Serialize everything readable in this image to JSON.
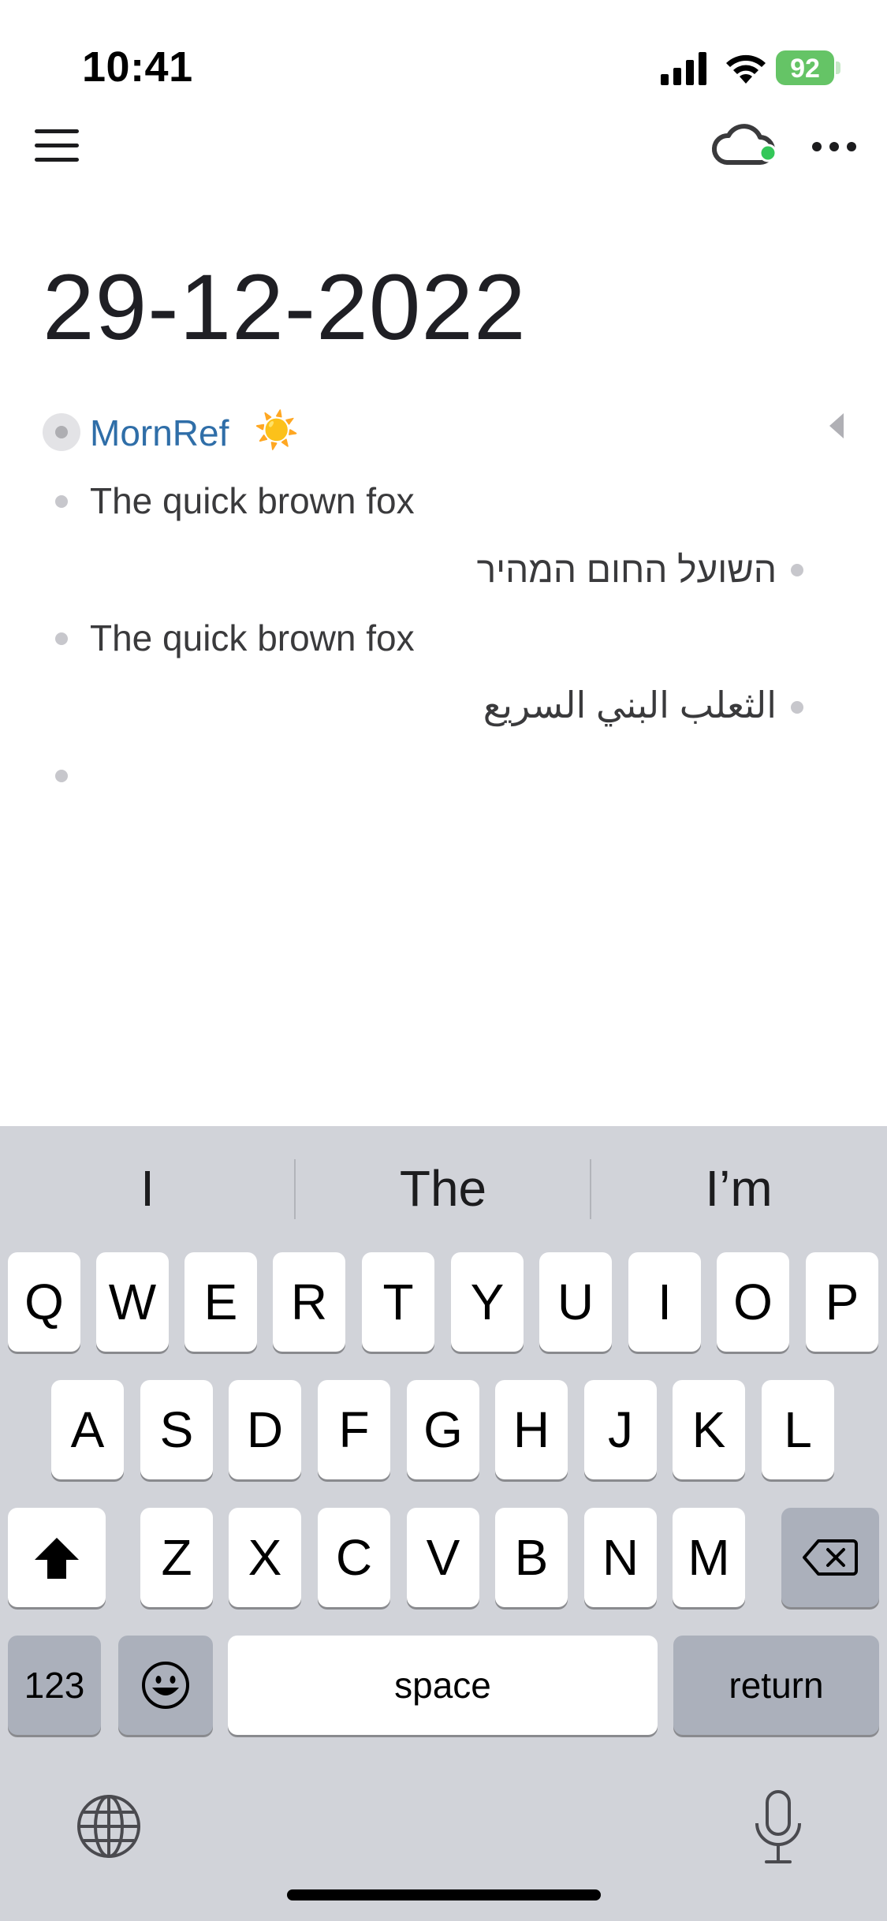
{
  "status_bar": {
    "time": "10:41",
    "battery": "92"
  },
  "toolbar": {
    "menu_icon": "hamburger-menu-icon",
    "sync_icon": "cloud-icon",
    "sync_status_color": "#34c759",
    "more_icon": "ellipsis-icon"
  },
  "page": {
    "title": "29-12-2022",
    "blocks": [
      {
        "text": "MornRef",
        "emoji": "☀️",
        "type": "page-reference",
        "direction": "ltr"
      },
      {
        "text": "The quick brown fox",
        "direction": "ltr"
      },
      {
        "text": "השועל החום המהיר",
        "direction": "rtl"
      },
      {
        "text": "The quick brown fox",
        "direction": "ltr"
      },
      {
        "text": "الثعلب البني السريع",
        "direction": "rtl"
      },
      {
        "text": "",
        "direction": "ltr"
      }
    ]
  },
  "keyboard": {
    "suggestions": [
      "I",
      "The",
      "I’m"
    ],
    "row1": [
      "Q",
      "W",
      "E",
      "R",
      "T",
      "Y",
      "U",
      "I",
      "O",
      "P"
    ],
    "row2": [
      "A",
      "S",
      "D",
      "F",
      "G",
      "H",
      "J",
      "K",
      "L"
    ],
    "row3": [
      "Z",
      "X",
      "C",
      "V",
      "B",
      "N",
      "M"
    ],
    "numbers_label": "123",
    "space_label": "space",
    "return_label": "return",
    "icons": [
      "shift-icon",
      "backspace-icon",
      "emoji-icon",
      "globe-icon",
      "microphone-icon"
    ]
  },
  "colors": {
    "link": "#2f6ea8",
    "battery": "#65c466",
    "keyboard_bg": "#d1d3d9"
  }
}
